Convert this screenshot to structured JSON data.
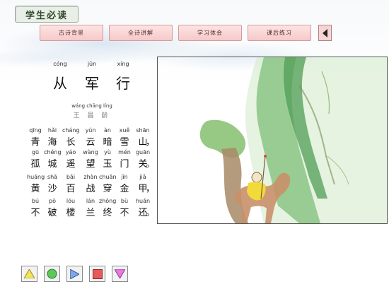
{
  "app": {
    "title": "学生必读"
  },
  "tabs": [
    {
      "label": "古诗背景"
    },
    {
      "label": "全诗讲解"
    },
    {
      "label": "学习体会"
    },
    {
      "label": "课后练习"
    }
  ],
  "poem": {
    "title": {
      "pinyin": [
        "cóng",
        "jūn",
        "xíng"
      ],
      "chars": [
        "从",
        "军",
        "行"
      ]
    },
    "author": {
      "pinyin": "wáng chāng líng",
      "name": "王 昌 龄"
    },
    "lines": [
      {
        "pinyin": [
          "qīng",
          "hǎi",
          "cháng",
          "yún",
          "àn",
          "xuě",
          "shān"
        ],
        "chars": [
          "青",
          "海",
          "长",
          "云",
          "暗",
          "雪",
          "山"
        ],
        "punct": "，"
      },
      {
        "pinyin": [
          "gū",
          "chéng",
          "yáo",
          "wàng",
          "yù",
          "mén",
          "guān"
        ],
        "chars": [
          "孤",
          "城",
          "遥",
          "望",
          "玉",
          "门",
          "关"
        ],
        "punct": "。"
      },
      {
        "pinyin": [
          "huáng",
          "shā",
          "bǎi",
          "zhàn",
          "chuān",
          "jīn",
          "jiǎ"
        ],
        "chars": [
          "黄",
          "沙",
          "百",
          "战",
          "穿",
          "金",
          "甲"
        ],
        "punct": "，"
      },
      {
        "pinyin": [
          "bú",
          "pò",
          "lóu",
          "lán",
          "zhōng",
          "bù",
          "huán"
        ],
        "chars": [
          "不",
          "破",
          "楼",
          "兰",
          "终",
          "不",
          "还"
        ],
        "punct": "。"
      }
    ]
  },
  "colors": {
    "tab_fill": "#f6c9c9",
    "ctrl_triangle": "#f3e55a",
    "ctrl_circle": "#5cc85c",
    "ctrl_play": "#7fa8e8",
    "ctrl_stop": "#e85858",
    "ctrl_down": "#e878e0"
  },
  "controls": [
    {
      "icon": "triangle-up-icon"
    },
    {
      "icon": "circle-icon"
    },
    {
      "icon": "play-icon"
    },
    {
      "icon": "stop-icon"
    },
    {
      "icon": "triangle-down-icon"
    }
  ]
}
